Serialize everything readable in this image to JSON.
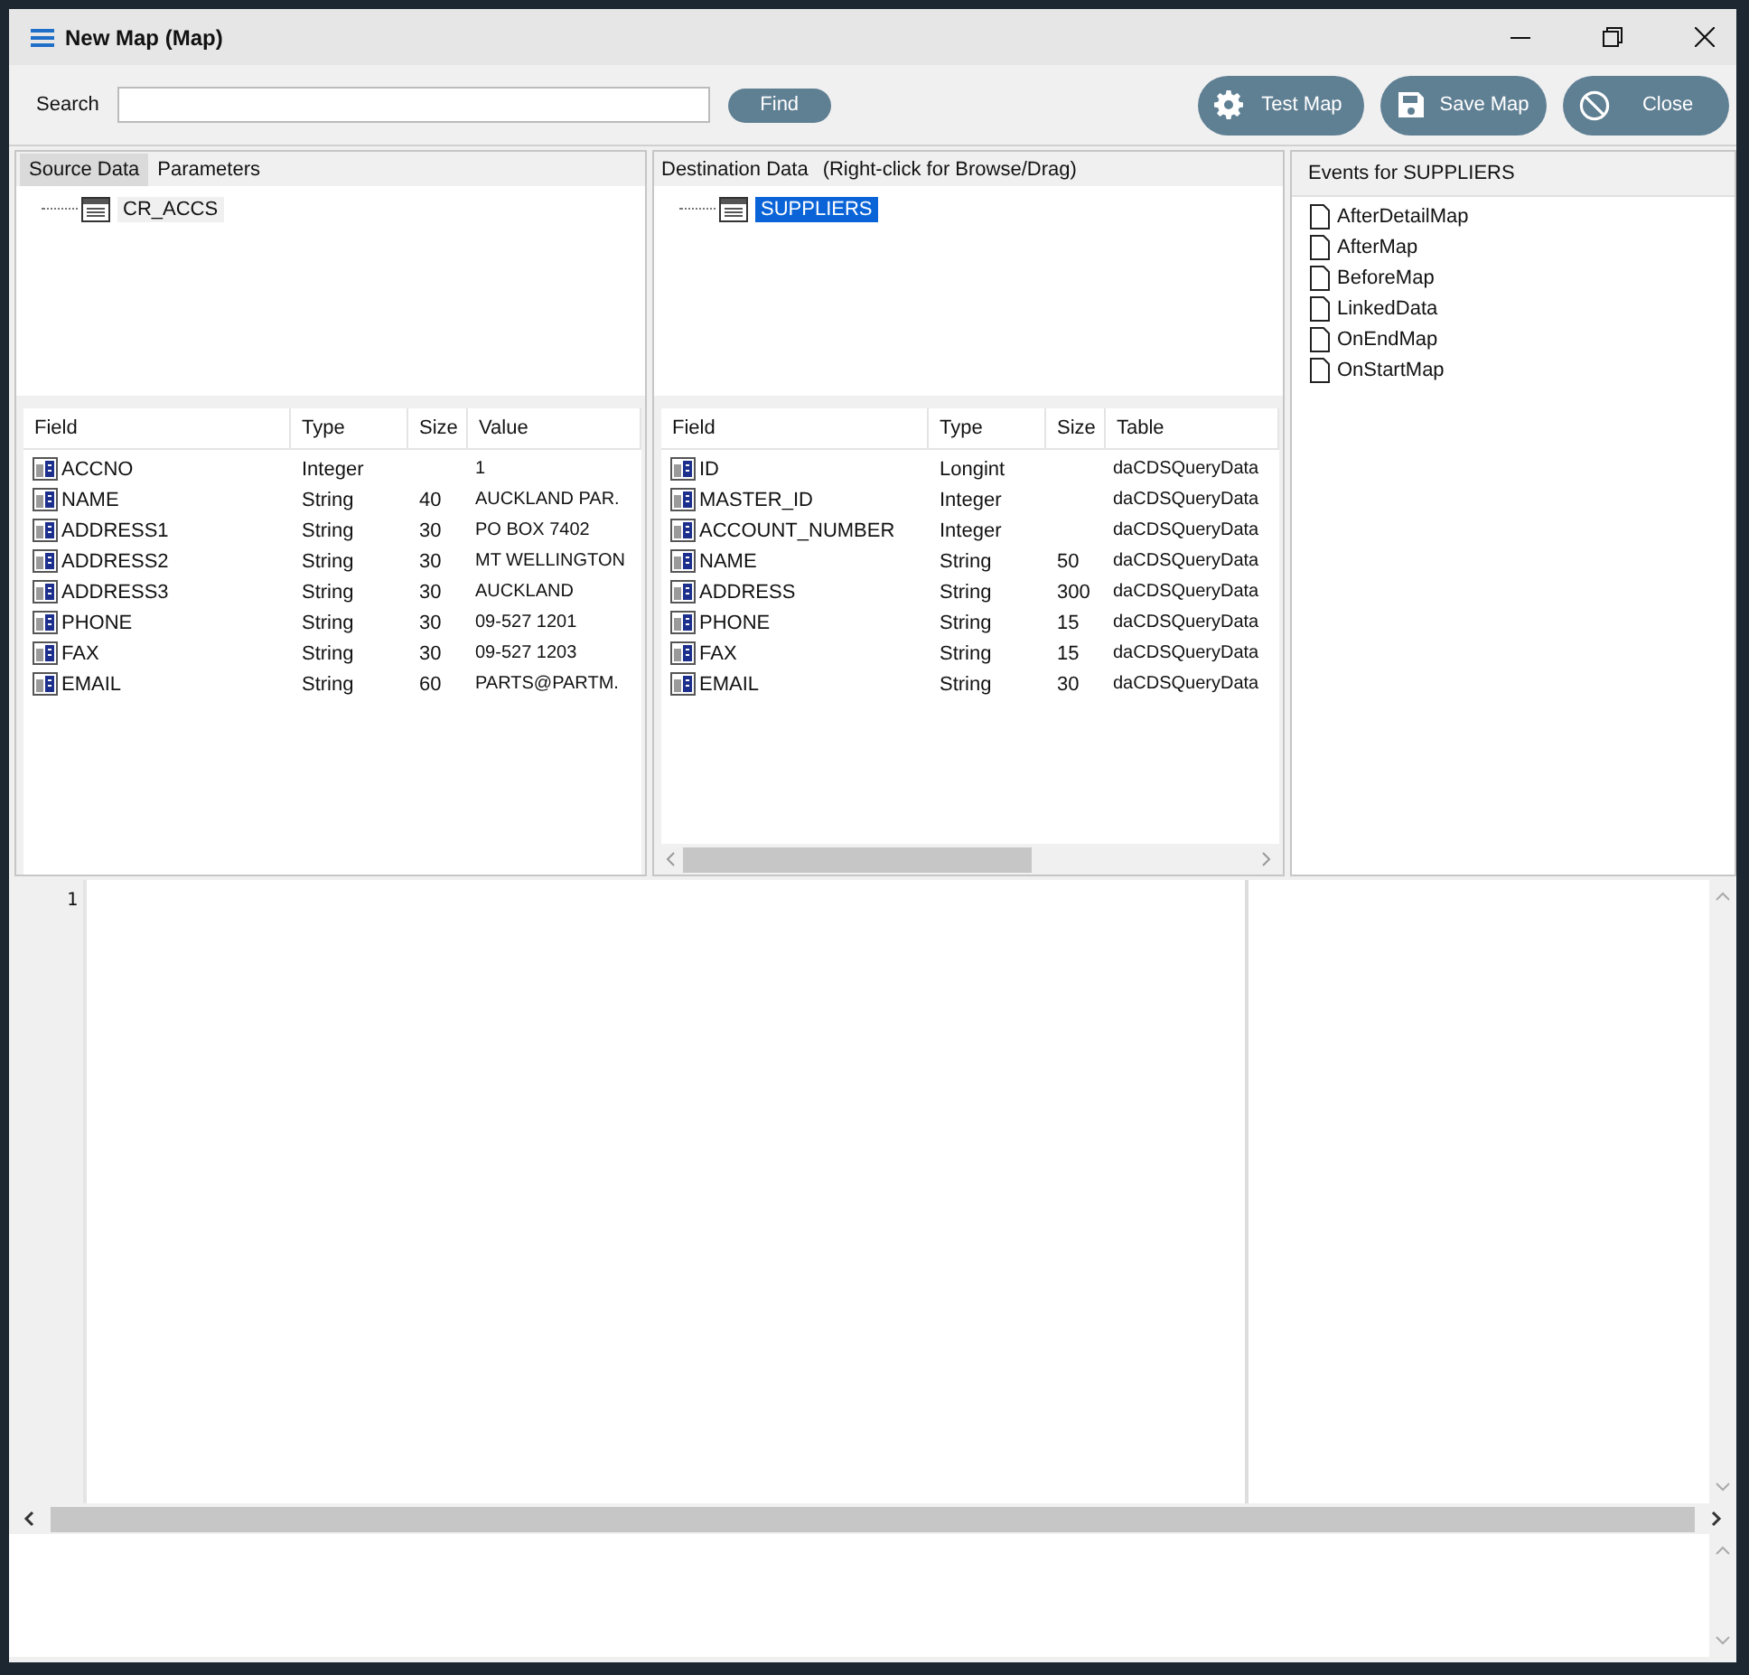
{
  "window": {
    "title": "New Map (Map)"
  },
  "toolbar": {
    "search_label": "Search",
    "find_button": "Find",
    "buttons": [
      {
        "label": "Test Map",
        "kind": "gear"
      },
      {
        "label": "Save Map",
        "kind": "save"
      },
      {
        "label": "Close",
        "kind": "cancel"
      }
    ]
  },
  "source": {
    "tabs": [
      {
        "label": "Source Data",
        "selected": true
      },
      {
        "label": "Parameters",
        "selected": false
      }
    ],
    "tree": [
      {
        "label": "CR_ACCS",
        "selected": false
      }
    ],
    "columns": [
      "Field",
      "Type",
      "Size",
      "Value"
    ],
    "rows": [
      {
        "field": "ACCNO",
        "type": "Integer",
        "value": "1"
      },
      {
        "field": "NAME",
        "type": "String",
        "size": "40",
        "value": "AUCKLAND PAR."
      },
      {
        "field": "ADDRESS1",
        "type": "String",
        "size": "30",
        "value": "PO BOX 7402"
      },
      {
        "field": "ADDRESS2",
        "type": "String",
        "size": "30",
        "value": "MT WELLINGTON"
      },
      {
        "field": "ADDRESS3",
        "type": "String",
        "size": "30",
        "value": "AUCKLAND"
      },
      {
        "field": "PHONE",
        "type": "String",
        "size": "30",
        "value": "09-527 1201"
      },
      {
        "field": "FAX",
        "type": "String",
        "size": "30",
        "value": "09-527 1203"
      },
      {
        "field": "EMAIL",
        "type": "String",
        "size": "60",
        "value": "PARTS@PARTM."
      }
    ]
  },
  "destination": {
    "title": "Destination Data",
    "hint": "(Right-click for Browse/Drag)",
    "tree": [
      {
        "label": "SUPPLIERS",
        "selected": true
      }
    ],
    "columns": [
      "Field",
      "Type",
      "Size",
      "Table"
    ],
    "rows": [
      {
        "field": "ID",
        "type": "Longint",
        "value": "daCDSQueryData"
      },
      {
        "field": "MASTER_ID",
        "type": "Integer",
        "value": "daCDSQueryData"
      },
      {
        "field": "ACCOUNT_NUMBER",
        "type": "Integer",
        "value": "daCDSQueryData"
      },
      {
        "field": "NAME",
        "type": "String",
        "size": "50",
        "value": "daCDSQueryData"
      },
      {
        "field": "ADDRESS",
        "type": "String",
        "size": "300",
        "value": "daCDSQueryData"
      },
      {
        "field": "PHONE",
        "type": "String",
        "size": "15",
        "value": "daCDSQueryData"
      },
      {
        "field": "FAX",
        "type": "String",
        "size": "15",
        "value": "daCDSQueryData"
      },
      {
        "field": "EMAIL",
        "type": "String",
        "size": "30",
        "value": "daCDSQueryData"
      }
    ]
  },
  "events": {
    "title": "Events for SUPPLIERS",
    "items": [
      "AfterDetailMap",
      "AfterMap",
      "BeforeMap",
      "LinkedData",
      "OnEndMap",
      "OnStartMap"
    ]
  },
  "editor": {
    "line_numbers": [
      "1"
    ]
  }
}
